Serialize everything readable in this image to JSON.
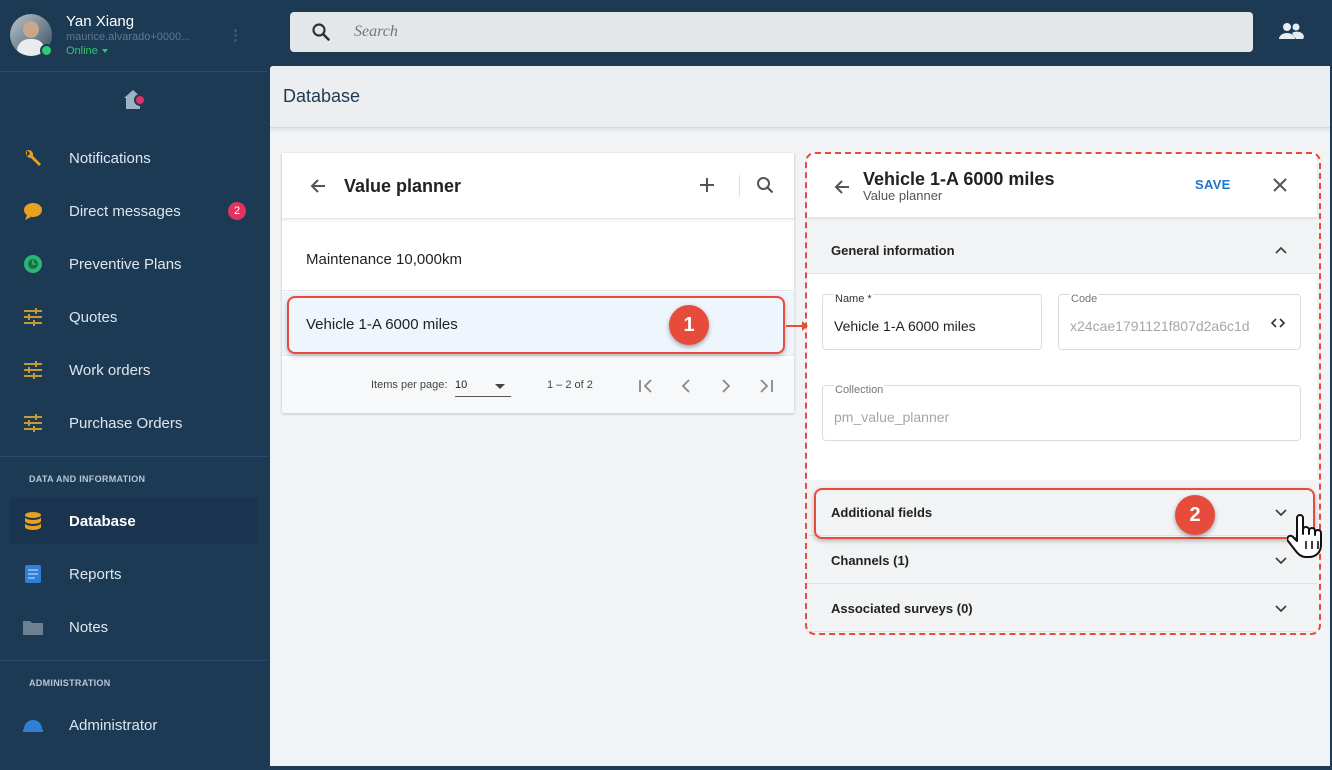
{
  "user": {
    "name": "Yan Xiang",
    "email": "maurice.alvarado+0000...",
    "status": "Online"
  },
  "sidebar": {
    "items": [
      {
        "label": "Notifications",
        "icon": "wrench-icon"
      },
      {
        "label": "Direct messages",
        "icon": "chat-bubble-icon",
        "badge": "2"
      },
      {
        "label": "Preventive Plans",
        "icon": "clock-globe-icon"
      },
      {
        "label": "Quotes",
        "icon": "sliders-icon"
      },
      {
        "label": "Work orders",
        "icon": "sliders-icon"
      },
      {
        "label": "Purchase Orders",
        "icon": "sliders-icon"
      }
    ],
    "section_data": "DATA AND INFORMATION",
    "data_items": [
      {
        "label": "Database",
        "icon": "database-icon",
        "active": true
      },
      {
        "label": "Reports",
        "icon": "document-icon"
      },
      {
        "label": "Notes",
        "icon": "folder-icon"
      }
    ],
    "section_admin": "ADMINISTRATION",
    "admin_items": [
      {
        "label": "Administrator",
        "icon": "helmet-icon"
      }
    ]
  },
  "search": {
    "placeholder": "Search"
  },
  "page": {
    "title": "Database"
  },
  "list_panel": {
    "title": "Value planner",
    "rows": [
      "Maintenance 10,000km",
      "Vehicle 1-A 6000 miles"
    ],
    "pager": {
      "items_per_page_label": "Items per page:",
      "items_per_page_value": "10",
      "range": "1 – 2 of 2"
    }
  },
  "detail": {
    "title": "Vehicle 1-A 6000 miles",
    "subtitle": "Value planner",
    "save_label": "SAVE",
    "sections": {
      "general": "General information",
      "additional": "Additional fields",
      "channels": "Channels (1)",
      "surveys": "Associated surveys (0)"
    },
    "fields": {
      "name_label": "Name *",
      "name_value": "Vehicle 1-A 6000 miles",
      "code_label": "Code",
      "code_value": "x24cae1791121f807d2a6c1d",
      "collection_label": "Collection",
      "collection_value": "pm_value_planner"
    }
  },
  "annotations": {
    "step1": "1",
    "step2": "2"
  },
  "colors": {
    "sidebar_bg": "#1d3a55",
    "accent_blue": "#1976d2",
    "annotation_red": "#e64b3c",
    "badge_pink": "#e0335f",
    "online_green": "#33c36f"
  }
}
